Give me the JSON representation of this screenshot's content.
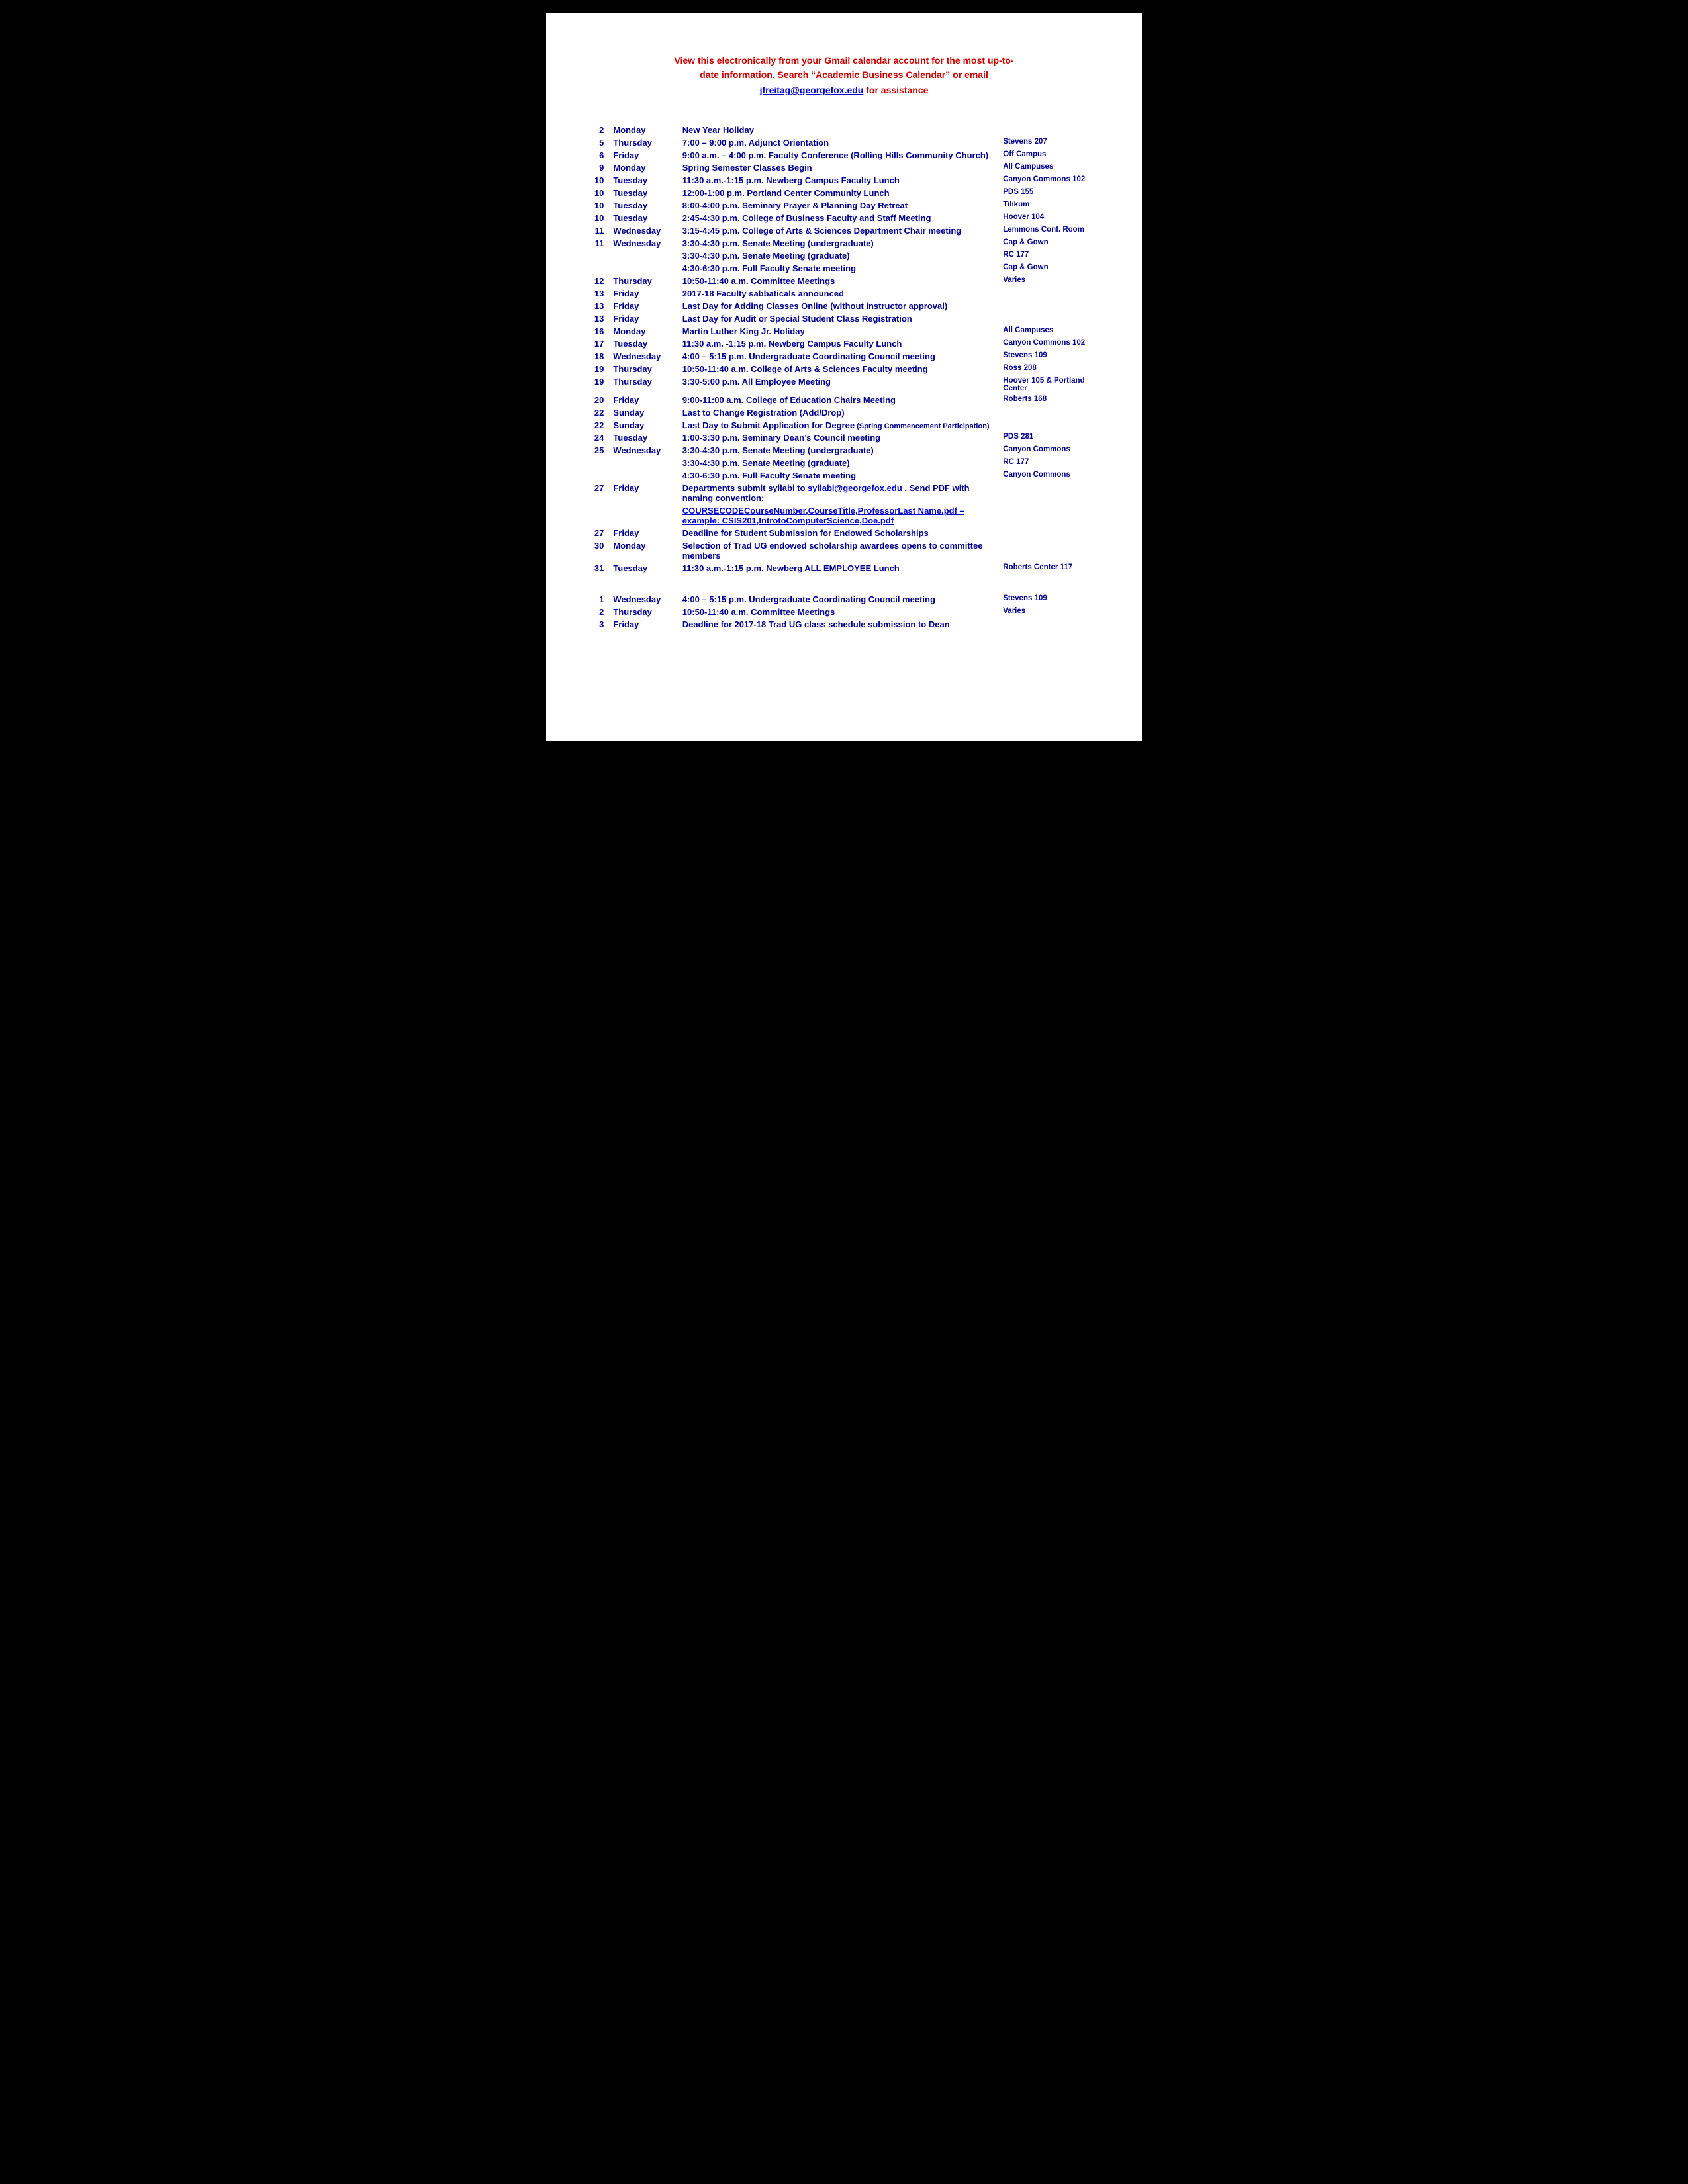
{
  "header": {
    "line1": "View this electronically from your Gmail calendar account for the most up-to-",
    "line2": "date information. Search “Academic Business Calendar” or email",
    "email": "jfreitag@georgefox.edu",
    "line3": " for assistance"
  },
  "rows": [
    {
      "day": "2",
      "dow": "Monday",
      "event": "New Year Holiday",
      "location": ""
    },
    {
      "day": "5",
      "dow": "Thursday",
      "event": "7:00 – 9:00 p.m. Adjunct Orientation",
      "location": "Stevens 207"
    },
    {
      "day": "6",
      "dow": "Friday",
      "event": "9:00 a.m. – 4:00 p.m. Faculty Conference (Rolling Hills Community Church)",
      "location": "Off Campus"
    },
    {
      "day": "9",
      "dow": "Monday",
      "event": "Spring Semester Classes Begin",
      "location": "All Campuses"
    },
    {
      "day": "10",
      "dow": "Tuesday",
      "event": "11:30 a.m.-1:15 p.m. Newberg Campus Faculty Lunch",
      "location": "Canyon Commons 102"
    },
    {
      "day": "10",
      "dow": "Tuesday",
      "event": "12:00-1:00 p.m. Portland Center Community Lunch",
      "location": "PDS 155"
    },
    {
      "day": "10",
      "dow": "Tuesday",
      "event": "8:00-4:00 p.m. Seminary Prayer & Planning Day Retreat",
      "location": "Tilikum"
    },
    {
      "day": "10",
      "dow": "Tuesday",
      "event": "2:45-4:30 p.m. College of Business Faculty and Staff Meeting",
      "location": "Hoover 104"
    },
    {
      "day": "11",
      "dow": "Wednesday",
      "event": "3:15-4:45 p.m. College of Arts & Sciences Department Chair meeting",
      "location": "Lemmons Conf. Room"
    },
    {
      "day": "11",
      "dow": "Wednesday",
      "event": "3:30-4:30 p.m. Senate Meeting (undergraduate)",
      "location": "Cap & Gown"
    },
    {
      "day": "",
      "dow": "",
      "event": "3:30-4:30 p.m. Senate Meeting (graduate)",
      "location": "RC 177"
    },
    {
      "day": "",
      "dow": "",
      "event": "4:30-6:30 p.m. Full Faculty Senate meeting",
      "location": "Cap & Gown"
    },
    {
      "day": "12",
      "dow": "Thursday",
      "event": "10:50-11:40 a.m. Committee Meetings",
      "location": "Varies"
    },
    {
      "day": "13",
      "dow": "Friday",
      "event": "2017-18 Faculty sabbaticals announced",
      "location": ""
    },
    {
      "day": "13",
      "dow": "Friday",
      "event": "Last Day for Adding Classes Online (without instructor approval)",
      "location": ""
    },
    {
      "day": "13",
      "dow": "Friday",
      "event": "Last Day for Audit or Special Student Class Registration",
      "location": ""
    },
    {
      "day": "16",
      "dow": "Monday",
      "event": "Martin Luther King Jr. Holiday",
      "location": "All Campuses"
    },
    {
      "day": "17",
      "dow": "Tuesday",
      "event": "11:30 a.m. -1:15 p.m. Newberg Campus Faculty Lunch",
      "location": "Canyon Commons 102"
    },
    {
      "day": "18",
      "dow": "Wednesday",
      "event": "4:00 – 5:15 p.m. Undergraduate Coordinating Council meeting",
      "location": "Stevens 109"
    },
    {
      "day": "19",
      "dow": "Thursday",
      "event": "10:50-11:40 a.m. College of Arts & Sciences Faculty meeting",
      "location": "Ross 208"
    },
    {
      "day": "19",
      "dow": "Thursday",
      "event": "3:30-5:00 p.m. All Employee Meeting",
      "location": "Hoover 105 & Portland Center"
    },
    {
      "day": "20",
      "dow": "Friday",
      "event": "9:00-11:00 a.m. College of Education Chairs Meeting",
      "location": "Roberts 168"
    },
    {
      "day": "22",
      "dow": "Sunday",
      "event": "Last to Change Registration (Add/Drop)",
      "location": ""
    },
    {
      "day": "22",
      "dow": "Sunday",
      "event": "Last Day to Submit Application for Degree",
      "location": "(Spring Commencement Participation)",
      "small": true
    },
    {
      "day": "24",
      "dow": "Tuesday",
      "event": "1:00-3:30 p.m. Seminary Dean’s Council meeting",
      "location": "PDS 281"
    },
    {
      "day": "25",
      "dow": "Wednesday",
      "event": "3:30-4:30 p.m. Senate Meeting (undergraduate)",
      "location": "Canyon Commons"
    },
    {
      "day": "",
      "dow": "",
      "event": "3:30-4:30 p.m. Senate Meeting (graduate)",
      "location": "RC 177"
    },
    {
      "day": "",
      "dow": "",
      "event": "4:30-6:30 p.m. Full Faculty Senate meeting",
      "location": "Canyon Commons"
    },
    {
      "day": "27",
      "dow": "Friday",
      "event": "Departments submit syllabi to syllabi@georgefox.edu . Send PDF with naming convention:",
      "location": "",
      "link": true
    },
    {
      "day": "",
      "dow": "",
      "event": "COURSECODECourseNumber,CourseTitle,ProfessorLast Name.pdf – example: CSIS201,IntrotoComputerScience,Doe.pdf",
      "location": "",
      "underline": true
    },
    {
      "day": "27",
      "dow": "Friday",
      "event": "Deadline for Student Submission for Endowed Scholarships",
      "location": ""
    },
    {
      "day": "30",
      "dow": "Monday",
      "event": "Selection of Trad UG endowed scholarship awardees opens to committee members",
      "location": ""
    },
    {
      "day": "31",
      "dow": "Tuesday",
      "event": "11:30 a.m.-1:15 p.m. Newberg ALL EMPLOYEE Lunch",
      "location": "Roberts Center 117"
    },
    {
      "day": "spacer",
      "dow": "",
      "event": "",
      "location": ""
    },
    {
      "day": "1",
      "dow": "Wednesday",
      "event": "4:00 – 5:15 p.m. Undergraduate Coordinating Council meeting",
      "location": "Stevens 109"
    },
    {
      "day": "2",
      "dow": "Thursday",
      "event": "10:50-11:40 a.m. Committee Meetings",
      "location": "Varies"
    },
    {
      "day": "3",
      "dow": "Friday",
      "event": "Deadline for 2017-18 Trad UG class schedule submission to Dean",
      "location": ""
    }
  ]
}
